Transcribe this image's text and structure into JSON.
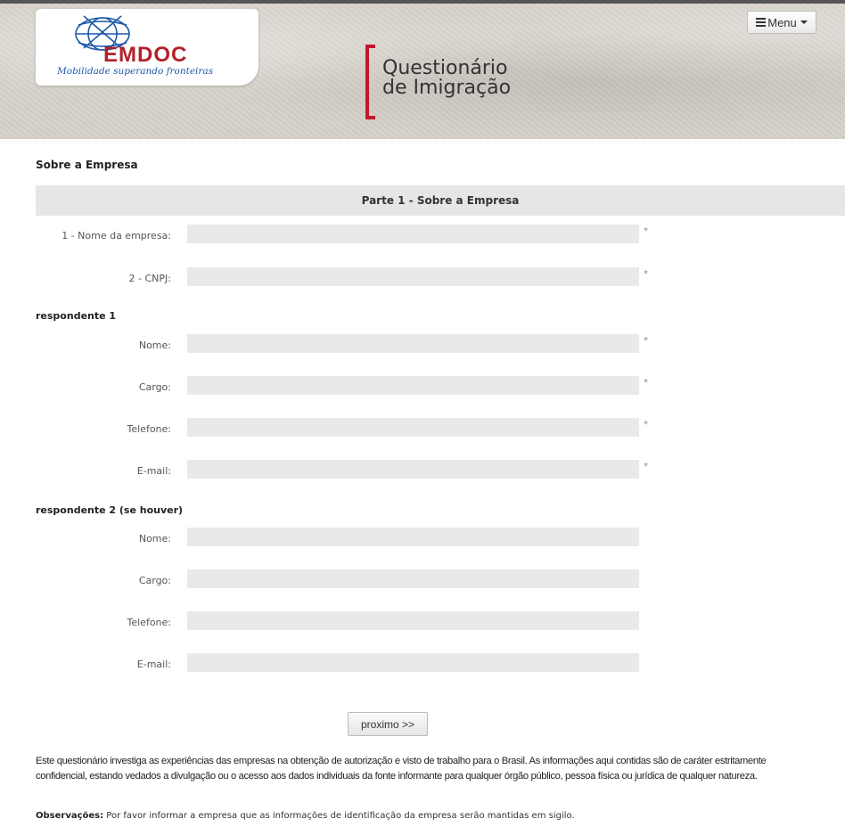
{
  "header": {
    "logo": {
      "name": "EMDOC",
      "tagline": "Mobilidade superando fronteiras"
    },
    "title_line1": "Questionário",
    "title_line2": "de Imigração",
    "menu_label": "Menu",
    "colors": {
      "brand_red": "#b51f2a",
      "brand_blue": "#1e57a8",
      "title_bracket": "#c0182a"
    }
  },
  "form": {
    "section_title": "Sobre a Empresa",
    "part_title": "Parte 1 - Sobre a Empresa",
    "required_marker": "*",
    "company_fields": [
      {
        "label": "1 - Nome da empresa:",
        "value": ""
      },
      {
        "label": "2 - CNPJ:",
        "value": ""
      }
    ],
    "respondent1": {
      "title": "respondente 1",
      "fields": [
        {
          "label": "Nome:",
          "value": ""
        },
        {
          "label": "Cargo:",
          "value": ""
        },
        {
          "label": "Telefone:",
          "value": ""
        },
        {
          "label": "E-mail:",
          "value": ""
        }
      ]
    },
    "respondent2": {
      "title": "respondente 2 (se houver)",
      "fields": [
        {
          "label": "Nome:",
          "value": ""
        },
        {
          "label": "Cargo:",
          "value": ""
        },
        {
          "label": "Telefone:",
          "value": ""
        },
        {
          "label": "E-mail:",
          "value": ""
        }
      ]
    },
    "next_button": "proximo >>"
  },
  "footer": {
    "disclaimer": "Este questionário investiga as experiências das empresas na obtenção de autorização e visto de trabalho para o Brasil. As informações aqui contidas são de caráter estritamente confidencial, estando vedados a divulgação ou o acesso aos dados individuais da fonte informante para qualquer órgão público, pessoa física ou jurídica de qualquer natureza.",
    "notes_label": "Observações:",
    "notes_text": " Por favor informar a empresa que as informações de identificação da empresa serão mantidas em sigilo."
  }
}
